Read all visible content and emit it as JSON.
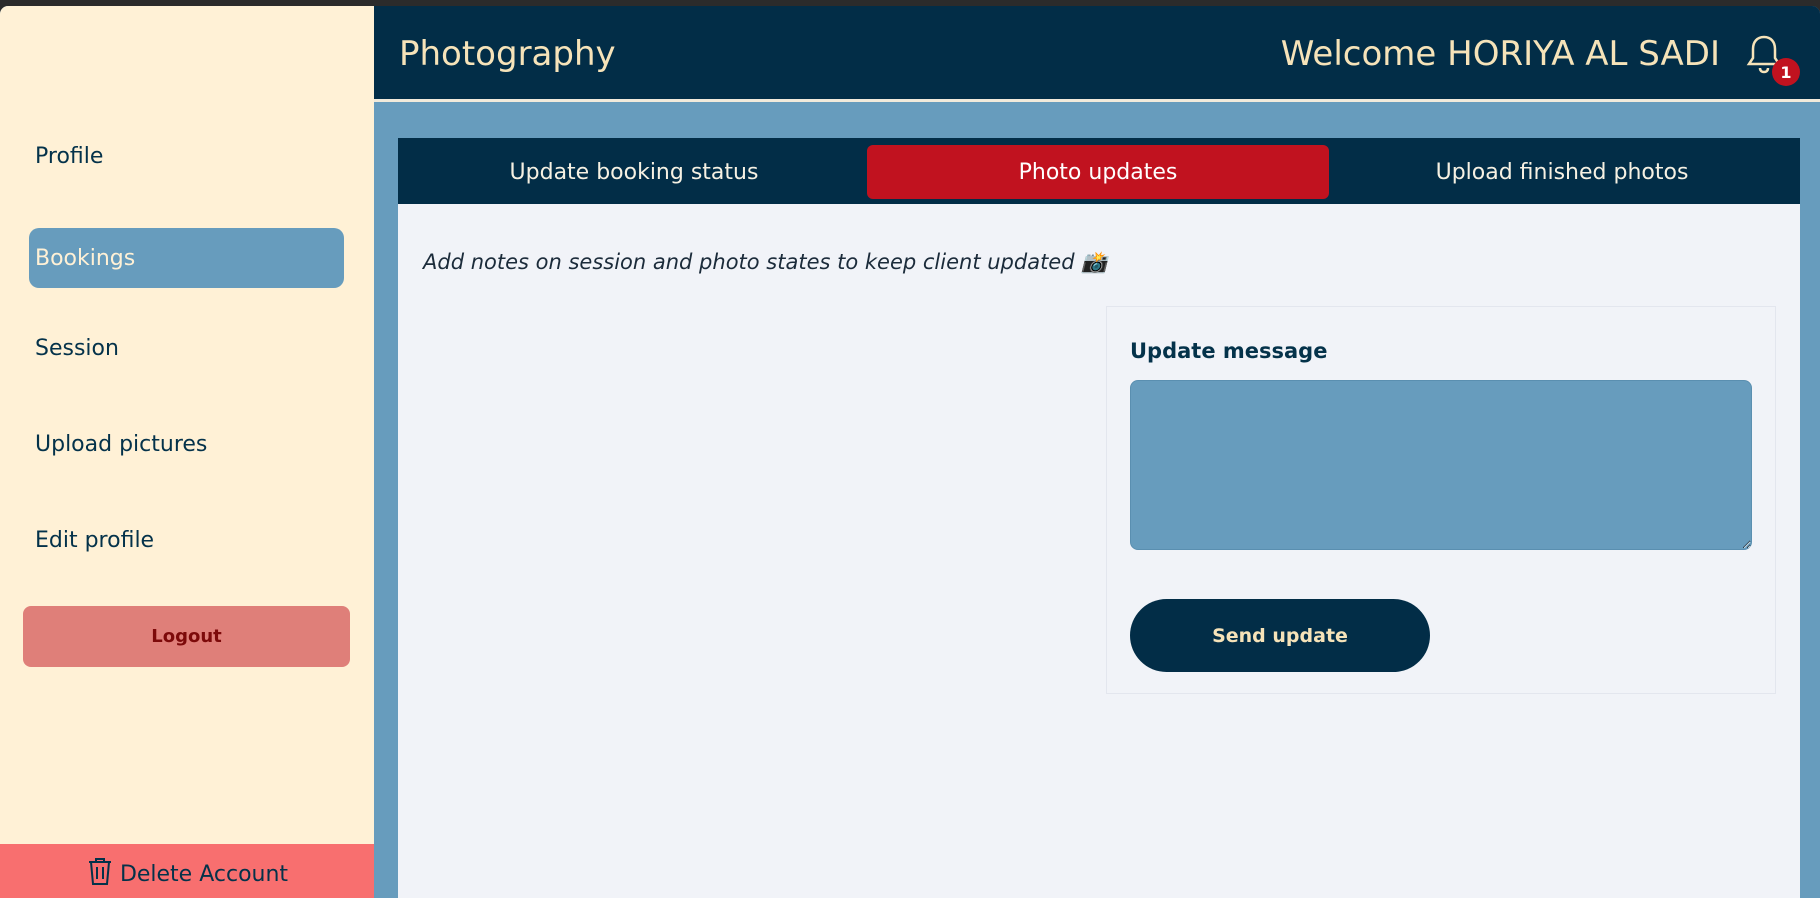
{
  "header": {
    "brand": "Photography",
    "welcome": "Welcome HORIYA AL SADI",
    "notification_count": "1"
  },
  "sidebar": {
    "items": [
      {
        "label": "Profile",
        "active": false
      },
      {
        "label": "Bookings",
        "active": true
      },
      {
        "label": "Session",
        "active": false
      },
      {
        "label": "Upload pictures",
        "active": false
      },
      {
        "label": "Edit profile",
        "active": false
      }
    ],
    "logout_label": "Logout",
    "delete_label": "Delete Account"
  },
  "tabs": [
    {
      "label": "Update booking status",
      "active": false
    },
    {
      "label": "Photo updates",
      "active": true
    },
    {
      "label": "Upload finished photos",
      "active": false
    }
  ],
  "main": {
    "intro": "Add notes on session and photo states to keep client updated 📸",
    "form_label": "Update message",
    "message_value": "",
    "send_label": "Send update"
  },
  "colors": {
    "navy": "#022d47",
    "cream": "#fff1d6",
    "steel_blue": "#679cbd",
    "accent_red": "#c1121f",
    "logout_bg": "#df7f79",
    "delete_bg": "#f86f6f"
  },
  "icons": {
    "notification": "bell-icon",
    "delete": "trash-icon"
  }
}
